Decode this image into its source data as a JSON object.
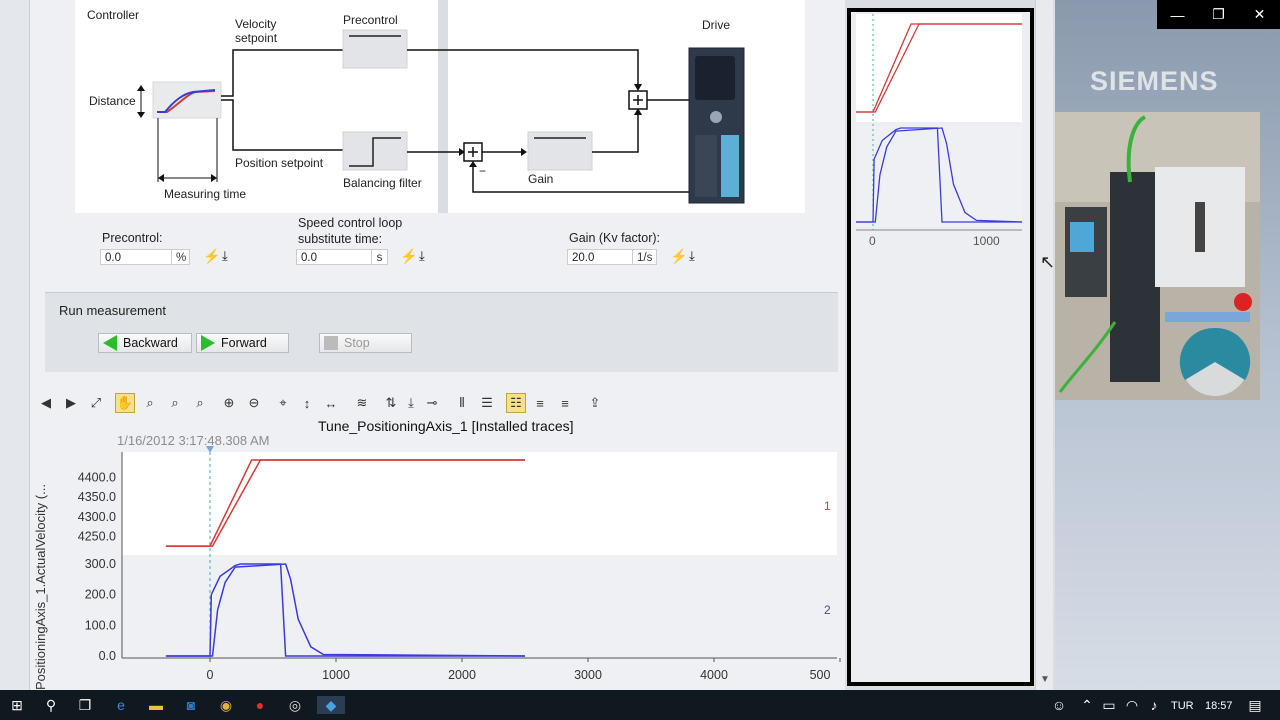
{
  "diagram": {
    "controller": "Controller",
    "velocity_setpoint": "Velocity\nsetpoint",
    "precontrol": "Precontrol",
    "drive": "Drive",
    "distance": "Distance",
    "position_setpoint": "Position setpoint",
    "measuring_time": "Measuring time",
    "balancing_filter": "Balancing filter",
    "gain": "Gain",
    "minus": "−"
  },
  "fields": {
    "precontrol": {
      "label": "Precontrol:",
      "value": "0.0",
      "unit": "%"
    },
    "speed_loop": {
      "label": "Speed control loop\nsubstitute time:",
      "value": "0.0",
      "unit": "s"
    },
    "gain": {
      "label": "Gain (Kv factor):",
      "value": "20.0",
      "unit": "1/s"
    }
  },
  "run": {
    "title": "Run measurement",
    "backward": "Backward",
    "forward": "Forward",
    "stop": "Stop"
  },
  "trace": {
    "title": "Tune_PositioningAxis_1 [Installed traces]",
    "timestamp": "1/16/2012 3:17:48.308 AM",
    "y_axis_label": "PositioningAxis_1.ActualVelocity (...",
    "upper_ticks": [
      "4400.0",
      "4350.0",
      "4300.0",
      "4250.0"
    ],
    "lower_ticks": [
      "300.0",
      "200.0",
      "100.0",
      "0.0"
    ],
    "x_ticks": [
      "0",
      "1000",
      "2000",
      "3000",
      "4000",
      "500"
    ],
    "channel_1": "1",
    "channel_2": "2"
  },
  "chart_data": {
    "type": "line",
    "charts": [
      {
        "panel": "upper",
        "ylim": [
          4210,
          4450
        ],
        "xlim": [
          -350,
          2500
        ],
        "series": [
          {
            "color": "#d23a3a",
            "x": [
              -350,
              0,
              330,
              2500
            ],
            "y": [
              4225,
              4225,
              4445,
              4445
            ]
          },
          {
            "color": "#d23a3a",
            "x": [
              -350,
              20,
              400,
              2500
            ],
            "y": [
              4225,
              4225,
              4445,
              4445
            ]
          }
        ]
      },
      {
        "panel": "lower",
        "ylim": [
          0,
          300
        ],
        "xlim": [
          -350,
          2500
        ],
        "series": [
          {
            "color": "#3b3bdc",
            "x": [
              -350,
              0,
              10,
              80,
              200,
              240,
              320,
              560,
              600,
              2500
            ],
            "y": [
              0,
              0,
              200,
              260,
              295,
              300,
              300,
              300,
              0,
              0
            ]
          },
          {
            "color": "#3b3bdc",
            "x": [
              -350,
              20,
              60,
              120,
              200,
              600,
              640,
              700,
              800,
              900,
              2500
            ],
            "y": [
              0,
              0,
              150,
              240,
              290,
              300,
              250,
              120,
              30,
              5,
              0
            ]
          }
        ]
      }
    ]
  },
  "mini_chart": {
    "x_ticks": [
      "0",
      "1000"
    ]
  },
  "siemens": {
    "logo": "SIEMENS"
  },
  "window": {
    "minimize": "—",
    "restore": "❐",
    "close": "✕"
  },
  "taskbar": {
    "lang": "TUR",
    "time": "18:57"
  },
  "colors": {
    "red_trace": "#d23a3a",
    "blue_trace": "#3b3bdc",
    "accent_green": "#2cbb2c"
  }
}
